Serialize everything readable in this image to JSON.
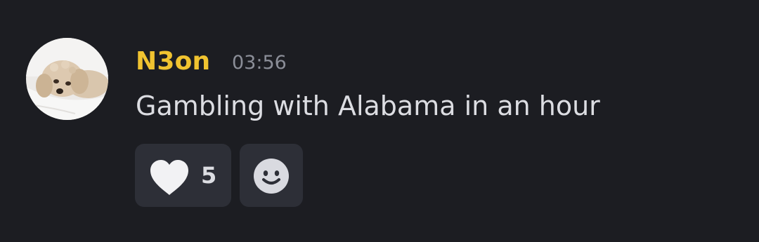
{
  "message": {
    "author": {
      "name": "N3on",
      "name_color": "#f0c330",
      "avatar_icon": "dog-photo-avatar"
    },
    "timestamp": "03:56",
    "text": "Gambling with Alabama in an hour"
  },
  "reactions": [
    {
      "icon": "heart-icon",
      "count": "5"
    }
  ],
  "add_reaction": {
    "icon": "smile-icon"
  },
  "colors": {
    "background": "#1c1d22",
    "reaction_bg": "#2d2f37",
    "text": "#dcdde2",
    "timestamp": "#8b8e98"
  }
}
